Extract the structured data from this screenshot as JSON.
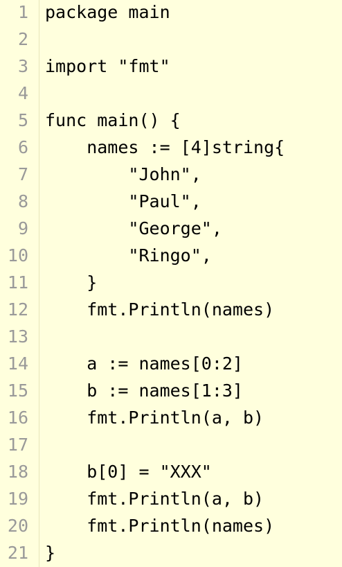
{
  "editor": {
    "background": "#ffffdd",
    "line_number_color": "#999999",
    "lines": [
      {
        "num": "1",
        "text": "package main"
      },
      {
        "num": "2",
        "text": ""
      },
      {
        "num": "3",
        "text": "import \"fmt\""
      },
      {
        "num": "4",
        "text": ""
      },
      {
        "num": "5",
        "text": "func main() {"
      },
      {
        "num": "6",
        "text": "    names := [4]string{"
      },
      {
        "num": "7",
        "text": "        \"John\","
      },
      {
        "num": "8",
        "text": "        \"Paul\","
      },
      {
        "num": "9",
        "text": "        \"George\","
      },
      {
        "num": "10",
        "text": "        \"Ringo\","
      },
      {
        "num": "11",
        "text": "    }"
      },
      {
        "num": "12",
        "text": "    fmt.Println(names)"
      },
      {
        "num": "13",
        "text": ""
      },
      {
        "num": "14",
        "text": "    a := names[0:2]"
      },
      {
        "num": "15",
        "text": "    b := names[1:3]"
      },
      {
        "num": "16",
        "text": "    fmt.Println(a, b)"
      },
      {
        "num": "17",
        "text": ""
      },
      {
        "num": "18",
        "text": "    b[0] = \"XXX\""
      },
      {
        "num": "19",
        "text": "    fmt.Println(a, b)"
      },
      {
        "num": "20",
        "text": "    fmt.Println(names)"
      },
      {
        "num": "21",
        "text": "}"
      }
    ]
  }
}
